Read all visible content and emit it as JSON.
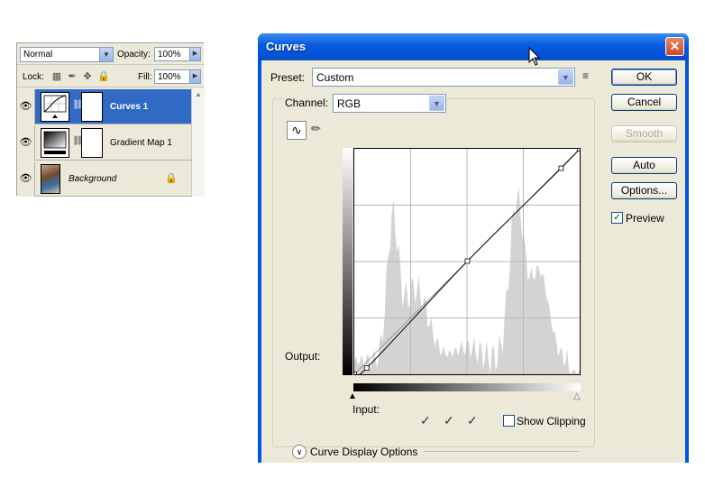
{
  "layers_panel": {
    "blend_mode": "Normal",
    "opacity_label": "Opacity:",
    "opacity_value": "100%",
    "lock_label": "Lock:",
    "fill_label": "Fill:",
    "fill_value": "100%",
    "layers": [
      {
        "name": "Curves 1",
        "selected": true
      },
      {
        "name": "Gradient Map 1",
        "selected": false
      },
      {
        "name": "Background",
        "selected": false
      }
    ]
  },
  "dialog": {
    "title": "Curves",
    "preset_label": "Preset:",
    "preset_value": "Custom",
    "channel_label": "Channel:",
    "channel_value": "RGB",
    "output_label": "Output:",
    "input_label": "Input:",
    "show_clipping_label": "Show Clipping",
    "show_clipping_checked": false,
    "curve_display_options_label": "Curve Display Options",
    "buttons": {
      "ok": "OK",
      "cancel": "Cancel",
      "smooth": "Smooth",
      "auto": "Auto",
      "options": "Options..."
    },
    "preview_label": "Preview",
    "preview_checked": true,
    "curve_points": [
      [
        0,
        0
      ],
      [
        14,
        7
      ],
      [
        128,
        128
      ],
      [
        234,
        233
      ],
      [
        255,
        255
      ]
    ],
    "colors": {
      "title_bar": "#0054e3",
      "selected_layer": "#316ac5",
      "close_button": "#d9583a",
      "histogram": "#d3d3d3"
    }
  }
}
